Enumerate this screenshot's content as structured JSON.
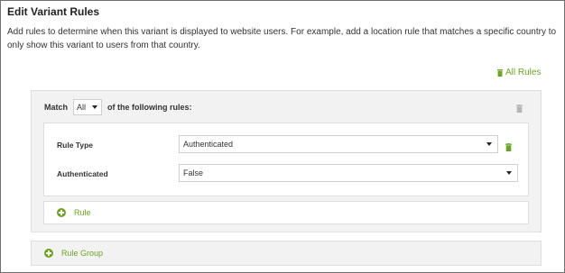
{
  "dialog": {
    "title": "Edit Variant Rules",
    "description": "Add rules to determine when this variant is displayed to website users. For example, add a location rule that matches a specific country to only show this variant to users from that country."
  },
  "toolbar": {
    "all_rules_label": "All Rules"
  },
  "rule_group": {
    "match_prefix": "Match",
    "match_value": "All",
    "match_suffix": "of the following rules:",
    "rules": [
      {
        "label": "Rule Type",
        "value": "Authenticated"
      },
      {
        "label": "Authenticated",
        "value": "False"
      }
    ],
    "add_rule_label": "Rule"
  },
  "add_rule_group_label": "Rule Group",
  "colors": {
    "accent": "#6aa520",
    "panel_bg": "#f2f2f2",
    "border": "#dedede",
    "trash_inactive": "#b5b5b5"
  },
  "icons": {
    "all_rules": "trash-icon",
    "group_delete": "trash-icon",
    "rule_delete": "trash-icon",
    "add": "plus-circle-icon",
    "dropdown": "chevron-down-icon"
  }
}
